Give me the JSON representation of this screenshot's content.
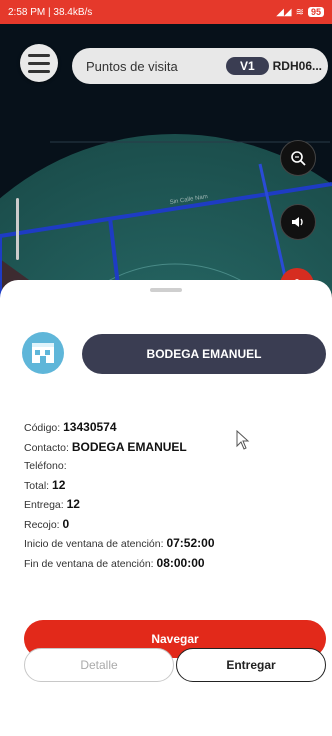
{
  "status_bar": {
    "time_info": "2:58 PM | 38.4kB/s",
    "battery": "95"
  },
  "header": {
    "title": "Puntos de visita",
    "version_badge": "V1",
    "route_code": "RDH06..."
  },
  "map": {
    "street_label": "Sin Calle Nam"
  },
  "store": {
    "name": "BODEGA EMANUEL"
  },
  "details": {
    "codigo_label": "Código:",
    "codigo_value": "13430574",
    "contacto_label": "Contacto:",
    "contacto_value": "BODEGA EMANUEL",
    "telefono_label": "Teléfono:",
    "total_label": "Total:",
    "total_value": "12",
    "entrega_label": "Entrega:",
    "entrega_value": "12",
    "recojo_label": "Recojo:",
    "recojo_value": "0",
    "inicio_label": "Inicio de ventana de atención:",
    "inicio_value": "07:52:00",
    "fin_label": "Fin de ventana de atención:",
    "fin_value": "08:00:00"
  },
  "actions": {
    "navegar": "Navegar",
    "detalle": "Detalle",
    "entregar": "Entregar"
  },
  "colors": {
    "accent_red": "#e2291a",
    "dark_pill": "#3a3d52",
    "store_icon": "#5fb6d9"
  }
}
